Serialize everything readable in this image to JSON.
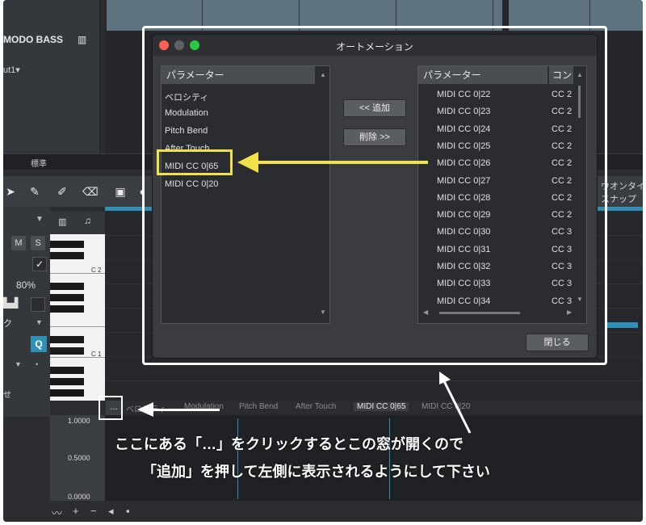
{
  "track": {
    "instrument_name": "MODO BASS",
    "output": "ut1",
    "std_label": "標準"
  },
  "toolbar": {
    "right_label_1": "ウオンタイ",
    "right_label_2": "スナップ"
  },
  "left_panel": {
    "m_label": "M",
    "s_label": "S",
    "check": "✓",
    "percent": "80%",
    "q_label": "Q",
    "track_label_1": "ク",
    "track_label_2": "せ"
  },
  "piano": {
    "c2": "C 2",
    "c1": "C 1"
  },
  "automation_tabs": [
    "ベロシティ",
    "Modulation",
    "Pitch Bend",
    "After Touch",
    "MIDI CC 0|65",
    "MIDI CC 0|20"
  ],
  "dots_label": "…",
  "automation_lane": {
    "y_max": "1.0000",
    "y_mid": "0.5000",
    "y_min": "0.0000"
  },
  "dialog": {
    "title": "オートメーション",
    "left_header": "パラメーター",
    "left_items": [
      "ベロシティ",
      "Modulation",
      "Pitch Bend",
      "After Touch",
      "MIDI CC 0|65",
      "MIDI CC 0|20"
    ],
    "add_button": "<< 追加",
    "remove_button": "削除 >>",
    "right_header": "パラメーター",
    "right_header_2": "コン",
    "right_items": [
      "MIDI CC 0|22",
      "MIDI CC 0|23",
      "MIDI CC 0|24",
      "MIDI CC 0|25",
      "MIDI CC 0|26",
      "MIDI CC 0|27",
      "MIDI CC 0|28",
      "MIDI CC 0|29",
      "MIDI CC 0|30",
      "MIDI CC 0|31",
      "MIDI CC 0|32",
      "MIDI CC 0|33",
      "MIDI CC 0|34"
    ],
    "right_col2": [
      "CC 2",
      "CC 2",
      "CC 2",
      "CC 2",
      "CC 2",
      "CC 2",
      "CC 2",
      "CC 2",
      "CC 3",
      "CC 3",
      "CC 3",
      "CC 3",
      "CC 3"
    ],
    "close_button": "閉じる"
  },
  "captions": {
    "line1": "ここにある「…」をクリックするとこの窓が開くので",
    "line2": "「追加」を押して左側に表示されるようにして下さい"
  },
  "colors": {
    "highlight": "#f1e24a",
    "accent_blue": "#2f8fb7",
    "traffic_close": "#ff5f57",
    "traffic_min": "#5f6266",
    "traffic_max": "#28c840"
  }
}
